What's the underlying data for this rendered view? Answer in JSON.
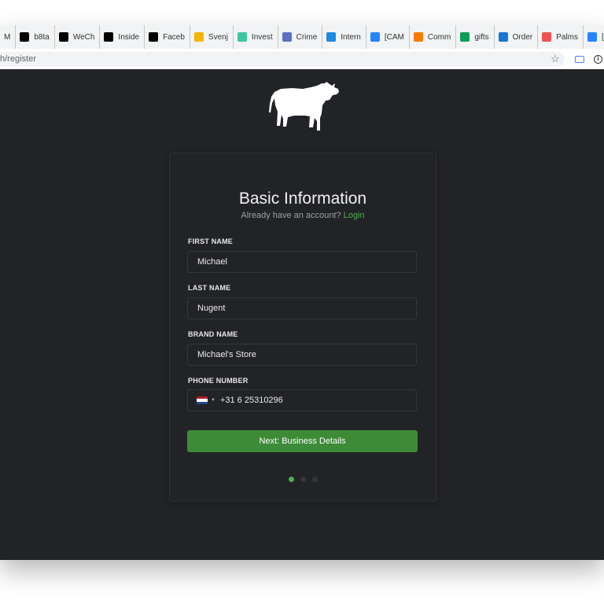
{
  "bookmarks": [
    {
      "label": "M",
      "icon": "mail-icon",
      "color": "#888888"
    },
    {
      "label": "b8ta",
      "icon": "b8ta-icon",
      "color": "#000000"
    },
    {
      "label": "WeCh",
      "icon": "f-icon",
      "color": "#000000"
    },
    {
      "label": "Inside",
      "icon": "inside-icon",
      "color": "#000000"
    },
    {
      "label": "Faceb",
      "icon": "facebook-icon",
      "color": "#000000"
    },
    {
      "label": "Svenj",
      "icon": "slides-icon",
      "color": "#f4b400"
    },
    {
      "label": "Invest",
      "icon": "leaf-icon",
      "color": "#3dc6a0"
    },
    {
      "label": "Crime",
      "icon": "snowflake-icon",
      "color": "#5b6fc4"
    },
    {
      "label": "Intern",
      "icon": "bolt-icon",
      "color": "#1e88e5"
    },
    {
      "label": "[CAM",
      "icon": "jira-icon",
      "color": "#2684ff"
    },
    {
      "label": "Comm",
      "icon": "dots-icon",
      "color": "#f57c00"
    },
    {
      "label": "gifts",
      "icon": "sheets-icon",
      "color": "#0f9d58"
    },
    {
      "label": "Order",
      "icon": "globe-icon",
      "color": "#1976d2"
    },
    {
      "label": "Palms",
      "icon": "palms-icon",
      "color": "#ef5350"
    },
    {
      "label": "[CAM",
      "icon": "jira-icon",
      "color": "#2684ff"
    }
  ],
  "address": {
    "url": "h/register"
  },
  "form": {
    "title": "Basic Information",
    "subtitle": "Already have an account?",
    "login_link": "Login",
    "fields": [
      {
        "label": "FIRST NAME",
        "value": "Michael"
      },
      {
        "label": "LAST NAME",
        "value": "Nugent"
      },
      {
        "label": "BRAND NAME",
        "value": "Michael's Store"
      },
      {
        "label": "PHONE NUMBER",
        "value": "+31 6 25310296"
      }
    ],
    "next_button": "Next: Business Details",
    "steps_total": 3,
    "current_step": 1
  },
  "colors": {
    "accent": "#3d8b37",
    "link": "#4caf50",
    "background": "#222326"
  }
}
